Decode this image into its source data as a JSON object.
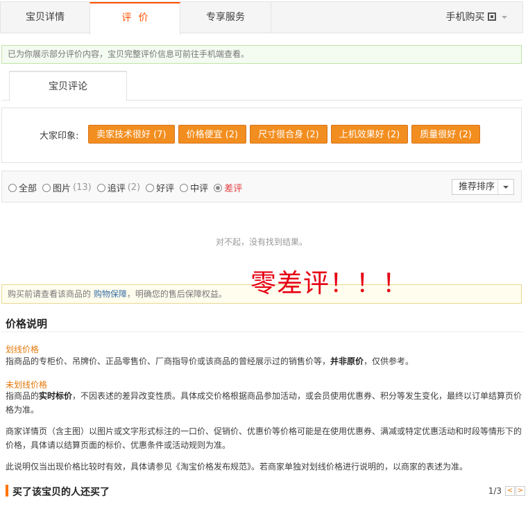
{
  "tabs": {
    "detail": "宝贝详情",
    "review": "评价",
    "service": "专享服务",
    "mobile": "手机购买"
  },
  "notice": "已为你展示部分评价内容，宝贝完整评价信息可前往手机端查看。",
  "subtab": "宝贝评论",
  "impressions": {
    "label": "大家印象:",
    "tags": [
      "卖家技术很好 (7)",
      "价格便宜 (2)",
      "尺寸很合身 (2)",
      "上机效果好 (2)",
      "质量很好 (2)"
    ]
  },
  "filters": {
    "options": [
      {
        "label": "全部",
        "count": ""
      },
      {
        "label": "图片",
        "count": "(13)"
      },
      {
        "label": "追评",
        "count": "(2)"
      },
      {
        "label": "好评",
        "count": ""
      },
      {
        "label": "中评",
        "count": ""
      },
      {
        "label": "差评",
        "count": ""
      }
    ],
    "selected": "差评",
    "sort_label": "推荐排序"
  },
  "empty_text": "对不起，没有找到结果。",
  "overlay_text": "零差评！！！",
  "guarantee": {
    "prefix": "购买前请查看该商品的",
    "link": "购物保障",
    "suffix": "，明确您的售后保障权益。"
  },
  "price": {
    "title": "价格说明",
    "strike_label": "划线价格",
    "strike_text_a": "指商品的专柜价、吊牌价、正品零售价、厂商指导价或该商品的曾经展示过的销售价等，",
    "strike_text_bold": "并非原价",
    "strike_text_b": "，仅供参考。",
    "unstrike_label": "未划线价格",
    "unstrike_text_a": "指商品的",
    "unstrike_text_bold": "实时标价",
    "unstrike_text_b": "，不因表述的差异改变性质。具体成交价格根据商品参加活动，或会员使用优惠券、积分等发生变化，最终以订单结算页价格为准。",
    "para3": "商家详情页（含主图）以图片或文字形式标注的一口价、促销价、优惠价等价格可能是在使用优惠券、满减或特定优惠活动和时段等情形下的价格，具体请以结算页面的标价、优惠条件或活动规则为准。",
    "para4": "此说明仅当出现价格比较时有效，具体请参见《淘宝价格发布规范》。若商家单独对划线价格进行说明的，以商家的表述为准。"
  },
  "also_bought": {
    "title": "买了该宝贝的人还买了",
    "pager": "1/3",
    "prev": "<",
    "next": ">"
  },
  "colors": {
    "accent": "#ff5000",
    "tag_bg": "#f28e1f",
    "red_overlay": "#e60012",
    "link": "#3a6ea5"
  }
}
